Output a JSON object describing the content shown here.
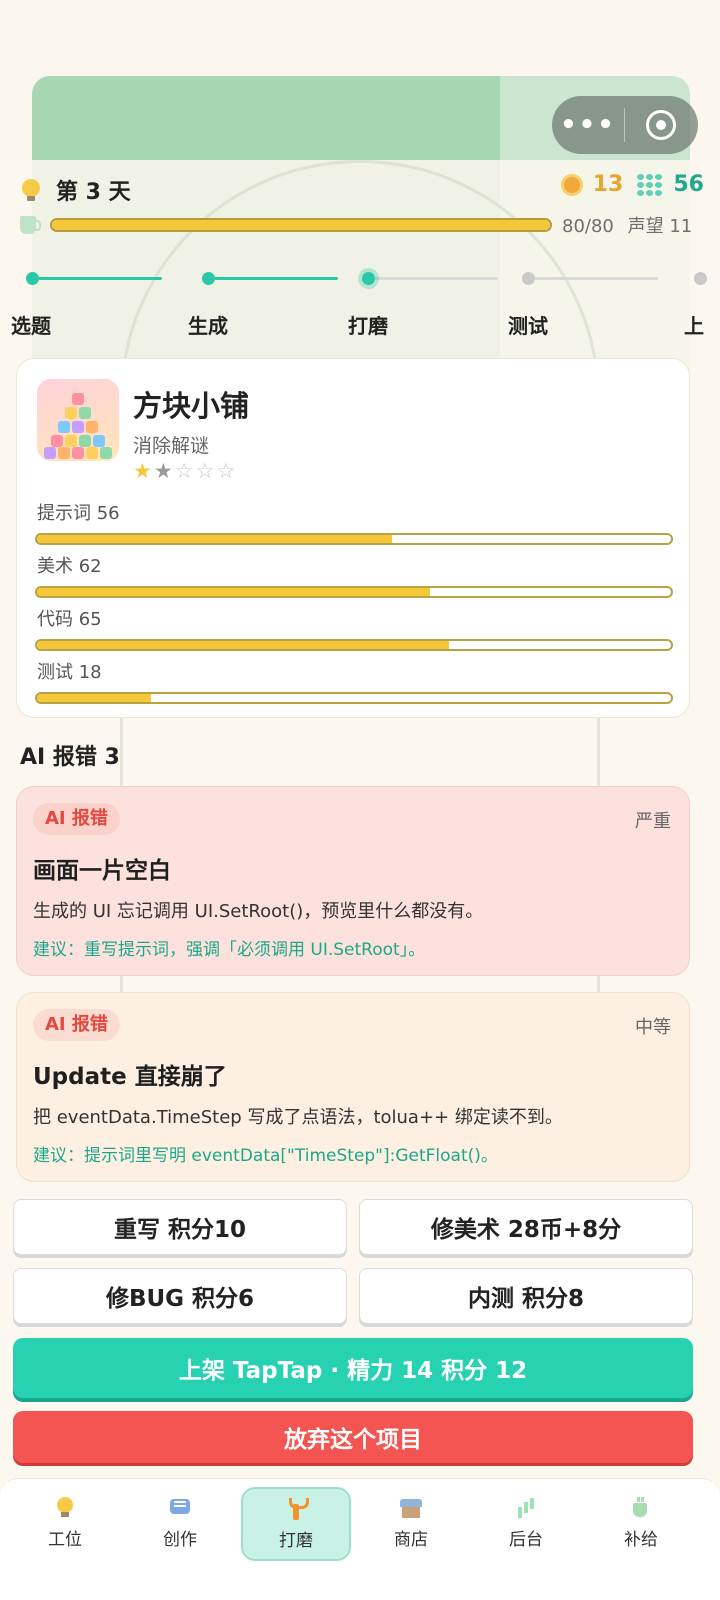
{
  "header": {
    "day_label": "第 3 天",
    "coins": "13",
    "gems": "56",
    "energy_text": "80/80",
    "energy_fraction": 1.0,
    "reputation": "声望 11"
  },
  "steps": [
    {
      "label": "选题",
      "state": "done"
    },
    {
      "label": "生成",
      "state": "done"
    },
    {
      "label": "打磨",
      "state": "current"
    },
    {
      "label": "测试",
      "state": "todo"
    },
    {
      "label": "上",
      "state": "todo"
    }
  ],
  "game": {
    "name": "方块小铺",
    "category": "消除解谜",
    "rating_stars": 1.5,
    "stars": [
      "★",
      "★",
      "☆",
      "☆",
      "☆"
    ],
    "stats": [
      {
        "label": "提示词  56",
        "value": 56
      },
      {
        "label": "美术  62",
        "value": 62
      },
      {
        "label": "代码  65",
        "value": 65
      },
      {
        "label": "测试  18",
        "value": 18
      }
    ]
  },
  "bugs_section": {
    "title": "AI 报错  3"
  },
  "bugs": [
    {
      "tag": "AI 报错",
      "severity": "严重",
      "title": "画面一片空白",
      "desc": "生成的 UI 忘记调用 UI.SetRoot()，预览里什么都没有。",
      "hint": "建议：重写提示词，强调「必须调用 UI.SetRoot」。"
    },
    {
      "tag": "AI 报错",
      "severity": "中等",
      "title": "Update 直接崩了",
      "desc": "把 eventData.TimeStep 写成了点语法，tolua++ 绑定读不到。",
      "hint": "建议：提示词里写明 eventData[\"TimeStep\"]:GetFloat()。"
    }
  ],
  "actions": {
    "rewrite": "重写 积分10",
    "fix_art": "修美术 28币+8分",
    "fix_bug": "修BUG 积分6",
    "beta_test": "内测 积分8",
    "publish": "上架 TapTap  ·  精力 14  积分 12",
    "abandon": "放弃这个项目"
  },
  "tabbar": [
    {
      "label": "工位",
      "icon": "lightbulb-icon"
    },
    {
      "label": "创作",
      "icon": "chat-icon"
    },
    {
      "label": "打磨",
      "icon": "wrench-icon",
      "active": true
    },
    {
      "label": "商店",
      "icon": "shop-icon"
    },
    {
      "label": "后台",
      "icon": "chart-icon"
    },
    {
      "label": "补给",
      "icon": "cup-icon"
    }
  ],
  "colors": {
    "accent": "#26d2b2",
    "danger": "#f45552",
    "bar": "#f5c73a",
    "coin": "#e8a42c",
    "gem": "#1ea98e"
  }
}
